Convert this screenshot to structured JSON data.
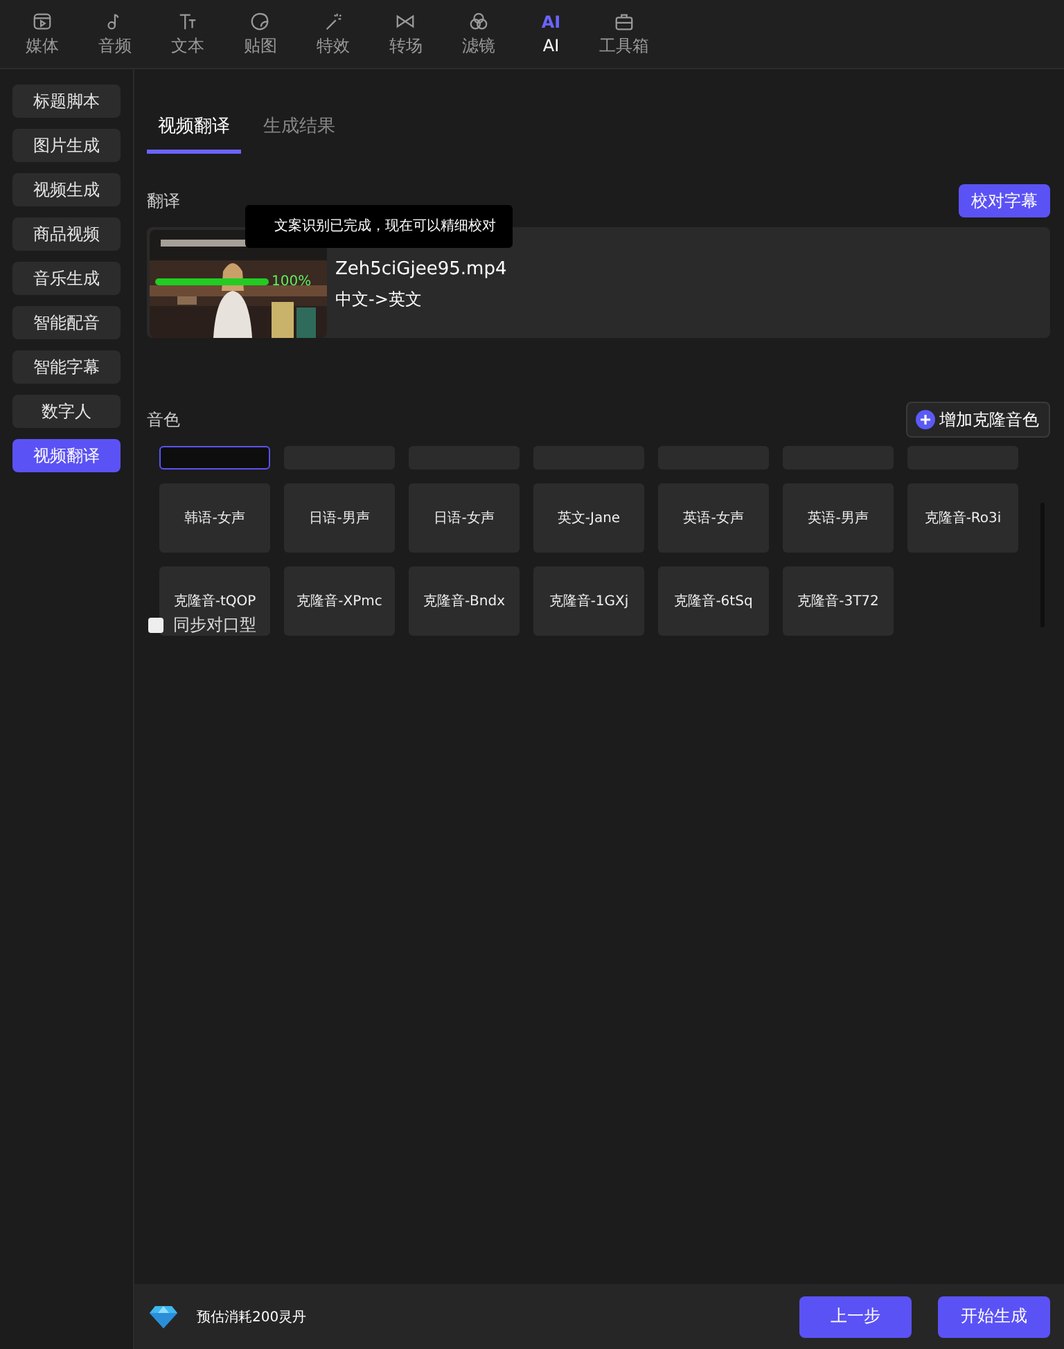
{
  "toolbar": {
    "items": [
      {
        "label": "媒体",
        "selected": false
      },
      {
        "label": "音频",
        "selected": false
      },
      {
        "label": "文本",
        "selected": false
      },
      {
        "label": "贴图",
        "selected": false
      },
      {
        "label": "特效",
        "selected": false
      },
      {
        "label": "转场",
        "selected": false
      },
      {
        "label": "滤镜",
        "selected": false
      },
      {
        "label": "AI",
        "icon_text": "AI",
        "selected": true
      },
      {
        "label": "工具箱",
        "selected": false
      }
    ]
  },
  "sidebar": {
    "items": [
      {
        "label": "标题脚本",
        "selected": false
      },
      {
        "label": "图片生成",
        "selected": false
      },
      {
        "label": "视频生成",
        "selected": false
      },
      {
        "label": "商品视频",
        "selected": false
      },
      {
        "label": "音乐生成",
        "selected": false
      },
      {
        "label": "智能配音",
        "selected": false
      },
      {
        "label": "智能字幕",
        "selected": false
      },
      {
        "label": "数字人",
        "selected": false
      },
      {
        "label": "视频翻译",
        "selected": true
      }
    ]
  },
  "tabs": [
    {
      "label": "视频翻译",
      "selected": true
    },
    {
      "label": "生成结果",
      "selected": false
    }
  ],
  "translation": {
    "label": "翻译",
    "button": "校对字幕",
    "tooltip": "文案识别已完成，现在可以精细校对",
    "video": {
      "filename": "Zeh5ciGjee95.mp4",
      "languages": "中文->英文",
      "progress": {
        "level": 1,
        "reading": "100%"
      }
    }
  },
  "voices": {
    "label": "音色",
    "add_button": "增加克隆音色",
    "blank_tiles": [
      {
        "selected": true
      },
      {
        "selected": false
      },
      {
        "selected": false
      },
      {
        "selected": false
      },
      {
        "selected": false
      },
      {
        "selected": false
      },
      {
        "selected": false
      }
    ],
    "tiles": [
      {
        "label": "韩语-女声"
      },
      {
        "label": "日语-男声"
      },
      {
        "label": "日语-女声"
      },
      {
        "label": "英文-Jane"
      },
      {
        "label": "英语-女声"
      },
      {
        "label": "英语-男声"
      },
      {
        "label": "克隆音-Ro3i"
      },
      {
        "label": "克隆音-tQOP"
      },
      {
        "label": "克隆音-XPmc"
      },
      {
        "label": "克隆音-Bndx"
      },
      {
        "label": "克隆音-1GXj"
      },
      {
        "label": "克隆音-6tSq"
      },
      {
        "label": "克隆音-3T72"
      }
    ],
    "lip_sync": {
      "label": "同步对口型",
      "checked": false
    }
  },
  "footer": {
    "cost": "预估消耗200灵丹",
    "buttons": [
      "上一步",
      "开始生成"
    ]
  }
}
